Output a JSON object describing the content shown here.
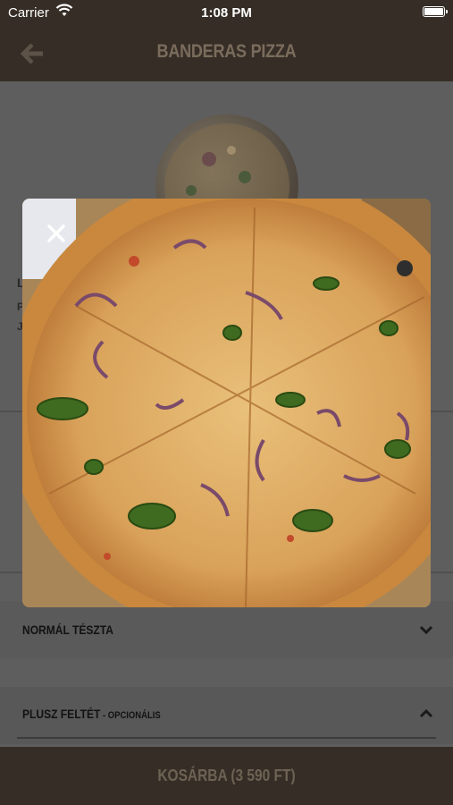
{
  "status_bar": {
    "carrier": "Carrier",
    "time": "1:08 PM"
  },
  "nav": {
    "title": "BANDERAS PIZZA",
    "back_icon": "arrow-left-icon"
  },
  "background_fragments": {
    "line1": "L",
    "line2": "P",
    "line3": "J"
  },
  "options": {
    "dough": {
      "label": "NORMÁL TÉSZTA",
      "icon": "chevron-down-icon"
    },
    "extras": {
      "label": "PLUSZ FELTÉT",
      "sub": " - OPCIONÁLIS",
      "icon": "chevron-up-icon"
    }
  },
  "cart": {
    "label": "KOSÁRBA (3 590 FT)"
  },
  "modal": {
    "close_icon": "close-icon",
    "image": "pizza-photo"
  },
  "colors": {
    "header": "#362e26",
    "overlay": "#5e5e5e",
    "title_text": "#7a6c5c"
  }
}
